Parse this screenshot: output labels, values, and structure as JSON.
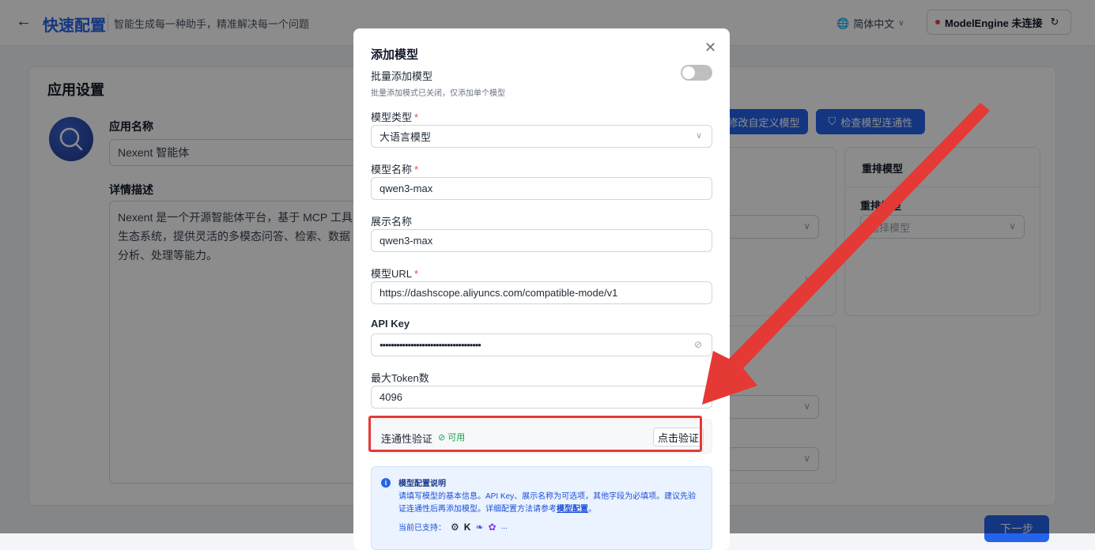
{
  "topbar": {
    "back_icon": "arrow-left-icon",
    "title": "快速配置",
    "subtitle": "智能生成每一种助手，精准解决每一个问题",
    "language": "简体中文",
    "engine_status": "ModelEngine 未连接"
  },
  "settings": {
    "title": "应用设置",
    "app_name_label": "应用名称",
    "app_name_value": "Nexent 智能体",
    "description_label": "详情描述",
    "description_value": "Nexent 是一个开源智能体平台，基于 MCP 工具生态系统，提供灵活的多模态问答、检索、数据分析、处理等能力。",
    "btn_custom_model": "修改自定义模型",
    "btn_check_connectivity": "检查模型连通性",
    "rerank_title": "重排模型",
    "rerank_label": "重排模型",
    "rerank_placeholder": "选择模型",
    "next_button": "下一步"
  },
  "modal": {
    "title": "添加模型",
    "batch_label": "批量添加模型",
    "batch_hint": "批量添加模式已关闭，仅添加单个模型",
    "batch_enabled": false,
    "type_label": "模型类型",
    "type_value": "大语言模型",
    "name_label": "模型名称",
    "name_value": "qwen3-max",
    "display_label": "展示名称",
    "display_value": "qwen3-max",
    "url_label": "模型URL",
    "url_value": "https://dashscope.aliyuncs.com/compatible-mode/v1",
    "apikey_label": "API Key",
    "apikey_value": "••••••••••••••••••••••••••••••••••••",
    "max_token_label": "最大Token数",
    "max_token_value": "4096",
    "connectivity_label": "连通性验证",
    "connectivity_status": "可用",
    "verify_button": "点击验证",
    "info_title": "模型配置说明",
    "info_text": "请填写模型的基本信息。API Key、展示名称为可选项，其他字段为必填项。建议先验证连通性后再添加模型。详细配置方法请参考",
    "info_link": "模型配置",
    "supported_label": "当前已支持：",
    "supported_more": "..."
  },
  "colors": {
    "accent": "#2563eb",
    "annotation_red": "#e53935",
    "success": "#16a34a"
  }
}
